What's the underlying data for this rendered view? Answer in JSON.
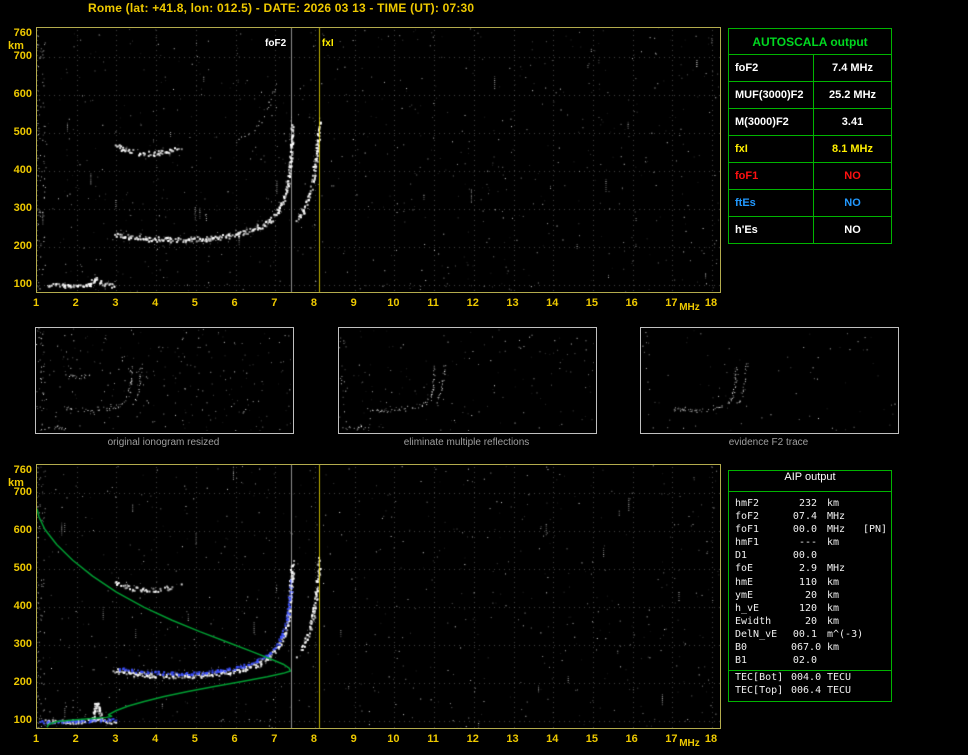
{
  "title": "Rome (lat: +41.8, lon: 012.5) - DATE: 2026 03 13 - TIME (UT): 07:30",
  "colors": {
    "title_text": "#eec900",
    "axis_text": "#eec900",
    "plot_border": "#b3ab4d",
    "table_border": "#00b400",
    "autoscala_title": "#00d820",
    "white": "#ffffff",
    "yellow": "#ffee00",
    "red": "#ff1111",
    "blue": "#2299ff",
    "fitted_blue": "#3c50ff",
    "profile_green": "#00a535",
    "caption_gray": "#9f9f9f"
  },
  "autoscala": {
    "title": "AUTOSCALA output",
    "rows": [
      {
        "label": "foF2",
        "value": "7.4 MHz",
        "color": "#ffffff"
      },
      {
        "label": "MUF(3000)F2",
        "value": "25.2 MHz",
        "color": "#ffffff"
      },
      {
        "label": "M(3000)F2",
        "value": "3.41",
        "color": "#ffffff"
      },
      {
        "label": "fxI",
        "value": "8.1 MHz",
        "color": "#ffee00"
      },
      {
        "label": "foF1",
        "value": "NO",
        "color": "#ff1111"
      },
      {
        "label": "ftEs",
        "value": "NO",
        "color": "#2299ff"
      },
      {
        "label": "h'Es",
        "value": "NO",
        "color": "#ffffff"
      }
    ]
  },
  "aip": {
    "title": "AIP output",
    "rows": [
      {
        "label": "hmF2",
        "value": "232",
        "unit": "km",
        "note": ""
      },
      {
        "label": "foF2",
        "value": "07.4",
        "unit": "MHz",
        "note": ""
      },
      {
        "label": "foF1",
        "value": "00.0",
        "unit": "MHz",
        "note": "[PN]"
      },
      {
        "label": "hmF1",
        "value": "---",
        "unit": "km",
        "note": ""
      },
      {
        "label": "D1",
        "value": "00.0",
        "unit": "",
        "note": ""
      },
      {
        "label": "foE",
        "value": "2.9",
        "unit": "MHz",
        "note": ""
      },
      {
        "label": "hmE",
        "value": "110",
        "unit": "km",
        "note": ""
      },
      {
        "label": "ymE",
        "value": "20",
        "unit": "km",
        "note": ""
      },
      {
        "label": "h_vE",
        "value": "120",
        "unit": "km",
        "note": ""
      },
      {
        "label": "Ewidth",
        "value": "20",
        "unit": "km",
        "note": ""
      },
      {
        "label": "DelN_vE",
        "value": "00.1",
        "unit": "m^(-3)",
        "note": ""
      },
      {
        "label": "B0",
        "value": "067.0",
        "unit": "km",
        "note": ""
      },
      {
        "label": "B1",
        "value": "02.0",
        "unit": "",
        "note": ""
      },
      {
        "label": "TEC[Bot]",
        "value": "004.0",
        "unit": "TECU",
        "note": "",
        "separator": true
      },
      {
        "label": "TEC[Top]",
        "value": "006.4",
        "unit": "TECU",
        "note": ""
      }
    ]
  },
  "thumbnails": [
    {
      "caption": "original ionogram resized",
      "traces": [
        0,
        1,
        2,
        3,
        4
      ],
      "noise": 260
    },
    {
      "caption": "eliminate multiple reflections",
      "traces": [
        0,
        1,
        2
      ],
      "noise": 150
    },
    {
      "caption": "evidence F2 trace",
      "traces": [
        1,
        2
      ],
      "noise": 70
    }
  ],
  "chart_data": [
    {
      "id": "ionogram-top",
      "type": "scatter",
      "xlabel": "MHz",
      "ylabel": "km",
      "xlim": [
        1,
        18.2
      ],
      "ylim": [
        82,
        775
      ],
      "xticks": [
        1,
        2,
        3,
        4,
        5,
        6,
        7,
        8,
        9,
        10,
        11,
        12,
        13,
        14,
        15,
        16,
        17,
        18
      ],
      "yticks": [
        760,
        700,
        600,
        500,
        400,
        300,
        200,
        100
      ],
      "markers_labeled": true,
      "markers": [
        {
          "label": "foF2",
          "x": 7.4,
          "color": "#ffffff",
          "label_side": "left"
        },
        {
          "label": "fxI",
          "x": 8.1,
          "color": "#ffee00",
          "label_side": "right"
        }
      ],
      "noise": {
        "dots": 700,
        "streaks": 30,
        "seed": 42
      },
      "traces": [
        {
          "name": "E-region echo",
          "color": "#ffffff",
          "size": 2,
          "jitter": 2,
          "density": 0.9,
          "fuzz": 0.4,
          "points": [
            [
              1.3,
              103
            ],
            [
              1.7,
              100
            ],
            [
              2.05,
              100
            ],
            [
              2.3,
              103
            ],
            [
              2.45,
              120
            ],
            [
              2.6,
              107
            ],
            [
              2.8,
              101
            ],
            [
              2.95,
              100
            ]
          ]
        },
        {
          "name": "F2 trace O-mode",
          "color": "#ffffff",
          "size": 2,
          "jitter": 2.6,
          "density": 0.97,
          "fuzz": 0.55,
          "points": [
            [
              2.95,
              234
            ],
            [
              3.3,
              228
            ],
            [
              3.8,
              223
            ],
            [
              4.3,
              221
            ],
            [
              4.8,
              221
            ],
            [
              5.3,
              224
            ],
            [
              5.8,
              230
            ],
            [
              6.2,
              239
            ],
            [
              6.55,
              252
            ],
            [
              6.85,
              270
            ],
            [
              7.05,
              295
            ],
            [
              7.2,
              325
            ],
            [
              7.3,
              365
            ],
            [
              7.36,
              415
            ],
            [
              7.4,
              470
            ],
            [
              7.42,
              520
            ]
          ]
        },
        {
          "name": "F2 trace X-mode",
          "color": "#ffffff",
          "size": 2,
          "jitter": 2.2,
          "density": 0.8,
          "fuzz": 0.4,
          "points": [
            [
              7.52,
              268
            ],
            [
              7.68,
              294
            ],
            [
              7.82,
              330
            ],
            [
              7.93,
              375
            ],
            [
              8.0,
              425
            ],
            [
              8.06,
              480
            ],
            [
              8.1,
              528
            ]
          ]
        },
        {
          "name": "second-hop echo",
          "color": "#ffffff",
          "size": 2,
          "jitter": 2.4,
          "density": 0.75,
          "fuzz": 0.45,
          "points": [
            [
              2.95,
              468
            ],
            [
              3.25,
              455
            ],
            [
              3.6,
              448
            ],
            [
              3.95,
              447
            ],
            [
              4.3,
              452
            ],
            [
              4.6,
              461
            ]
          ]
        },
        {
          "name": "second-hop cusp",
          "color": "#ffffff",
          "size": 1,
          "jitter": 3,
          "density": 0.35,
          "points": [
            [
              5.9,
              468
            ],
            [
              6.3,
              492
            ],
            [
              6.6,
              527
            ],
            [
              6.85,
              572
            ],
            [
              7.0,
              628
            ]
          ]
        }
      ],
      "lines": []
    },
    {
      "id": "ionogram-bottom",
      "type": "scatter",
      "xlabel": "MHz",
      "ylabel": "km",
      "xlim": [
        1,
        18.2
      ],
      "ylim": [
        82,
        775
      ],
      "xticks": [
        1,
        2,
        3,
        4,
        5,
        6,
        7,
        8,
        9,
        10,
        11,
        12,
        13,
        14,
        15,
        16,
        17,
        18
      ],
      "yticks": [
        760,
        700,
        600,
        500,
        400,
        300,
        200,
        100
      ],
      "markers_labeled": false,
      "markers": [
        {
          "label": "foF2",
          "x": 7.4,
          "color": "#ffffff"
        },
        {
          "label": "fxI",
          "x": 8.1,
          "color": "#ffee00"
        }
      ],
      "noise": {
        "dots": 620,
        "streaks": 24,
        "seed": 314
      },
      "traces": [
        {
          "name": "E-region echo",
          "color": "#ffffff",
          "size": 2,
          "jitter": 2,
          "density": 0.9,
          "fuzz": 0.4,
          "points": [
            [
              1.1,
              102
            ],
            [
              1.5,
              100
            ],
            [
              1.9,
              100
            ],
            [
              2.3,
              103
            ],
            [
              2.6,
              105
            ],
            [
              2.8,
              101
            ],
            [
              2.95,
              100
            ]
          ]
        },
        {
          "name": "F2 trace O-mode",
          "color": "#ffffff",
          "size": 2,
          "jitter": 2.6,
          "density": 0.97,
          "fuzz": 0.55,
          "points": [
            [
              2.95,
              234
            ],
            [
              3.3,
              228
            ],
            [
              3.8,
              223
            ],
            [
              4.3,
              221
            ],
            [
              4.8,
              221
            ],
            [
              5.3,
              224
            ],
            [
              5.8,
              230
            ],
            [
              6.2,
              239
            ],
            [
              6.55,
              252
            ],
            [
              6.85,
              270
            ],
            [
              7.05,
              295
            ],
            [
              7.2,
              325
            ],
            [
              7.3,
              365
            ],
            [
              7.36,
              415
            ],
            [
              7.4,
              470
            ],
            [
              7.42,
              520
            ]
          ]
        },
        {
          "name": "F2 trace X-mode",
          "color": "#ffffff",
          "size": 2,
          "jitter": 2.2,
          "density": 0.8,
          "fuzz": 0.4,
          "points": [
            [
              7.52,
              268
            ],
            [
              7.68,
              294
            ],
            [
              7.82,
              330
            ],
            [
              7.93,
              375
            ],
            [
              8.0,
              425
            ],
            [
              8.06,
              480
            ],
            [
              8.1,
              528
            ]
          ]
        },
        {
          "name": "second-hop echo",
          "color": "#ffffff",
          "size": 2,
          "jitter": 2.4,
          "density": 0.7,
          "fuzz": 0.4,
          "points": [
            [
              2.95,
              468
            ],
            [
              3.25,
              455
            ],
            [
              3.6,
              448
            ],
            [
              3.95,
              447
            ],
            [
              4.3,
              452
            ],
            [
              4.6,
              461
            ]
          ]
        },
        {
          "name": "Es spike",
          "color": "#ffffff",
          "size": 2,
          "jitter": 2,
          "density": 0.8,
          "points": [
            [
              2.38,
              104
            ],
            [
              2.44,
              126
            ],
            [
              2.49,
              152
            ],
            [
              2.54,
              134
            ],
            [
              2.6,
              108
            ]
          ]
        },
        {
          "name": "restored F2 trace",
          "color": "#3c50ff",
          "size": 2,
          "jitter": 1.6,
          "density": 0.85,
          "points": [
            [
              3.05,
              240
            ],
            [
              3.5,
              233
            ],
            [
              4.0,
              229
            ],
            [
              4.5,
              227
            ],
            [
              5.0,
              228
            ],
            [
              5.5,
              233
            ],
            [
              6.0,
              242
            ],
            [
              6.4,
              254
            ],
            [
              6.75,
              272
            ],
            [
              7.0,
              297
            ],
            [
              7.18,
              330
            ],
            [
              7.28,
              372
            ],
            [
              7.35,
              425
            ],
            [
              7.39,
              478
            ]
          ]
        },
        {
          "name": "restored E trace",
          "color": "#3c50ff",
          "size": 2,
          "jitter": 1.4,
          "density": 0.8,
          "points": [
            [
              1.1,
              99
            ],
            [
              1.5,
              100
            ],
            [
              1.9,
              101
            ],
            [
              2.3,
              102
            ],
            [
              2.7,
              104
            ],
            [
              2.95,
              107
            ]
          ]
        }
      ],
      "lines": [
        {
          "name": "electron density profile",
          "color": "#00a535",
          "width": 1.5,
          "points": [
            [
              1.25,
              84
            ],
            [
              1.3,
              92
            ],
            [
              1.5,
              99
            ],
            [
              1.9,
              103
            ],
            [
              2.4,
              107
            ],
            [
              2.75,
              110
            ],
            [
              2.88,
              113
            ],
            [
              2.8,
              117
            ],
            [
              2.85,
              120
            ],
            [
              3.0,
              128
            ],
            [
              3.3,
              140
            ],
            [
              3.7,
              152
            ],
            [
              4.2,
              165
            ],
            [
              4.8,
              178
            ],
            [
              5.5,
              192
            ],
            [
              6.2,
              205
            ],
            [
              6.8,
              217
            ],
            [
              7.2,
              226
            ],
            [
              7.38,
              232
            ],
            [
              7.35,
              240
            ],
            [
              7.2,
              250
            ],
            [
              6.9,
              263
            ],
            [
              6.4,
              284
            ],
            [
              5.8,
              308
            ],
            [
              5.1,
              336
            ],
            [
              4.4,
              366
            ],
            [
              3.7,
              400
            ],
            [
              3.0,
              440
            ],
            [
              2.4,
              482
            ],
            [
              1.9,
              524
            ],
            [
              1.5,
              565
            ],
            [
              1.2,
              605
            ],
            [
              1.05,
              638
            ],
            [
              1.0,
              660
            ]
          ]
        }
      ]
    }
  ]
}
